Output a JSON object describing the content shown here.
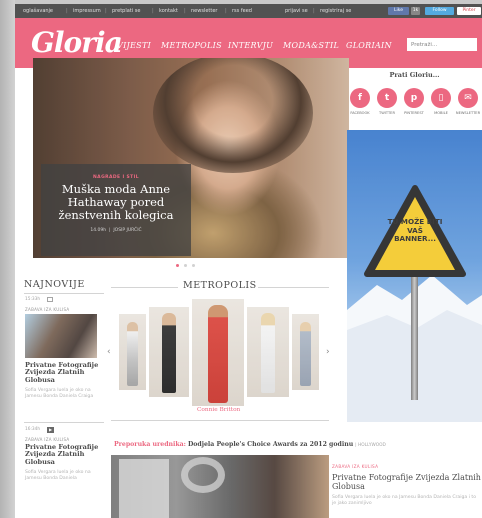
{
  "topbar": {
    "links": [
      "oglašavanje",
      "impressum",
      "pretplati se",
      "kontakt",
      "newsletter",
      "rss feed"
    ],
    "right_links": [
      "prijavi se",
      "registriraj se"
    ],
    "social": {
      "like": "Like",
      "count": "1k",
      "follow": "Follow",
      "pinterest": "Pinter"
    }
  },
  "header": {
    "logo": "Gloria",
    "nav": [
      "VIJESTI",
      "METROPOLIS",
      "INTERVJU",
      "MODA&STIL",
      "GLORIAIN"
    ],
    "search_placeholder": "Pretraži..."
  },
  "hero": {
    "kicker": "NAGRADE I STIL",
    "title": "Muška moda Anne Hathaway pored ženstvenih kolegica",
    "date": "14.09h",
    "author": "JOSIP JURČIĆ"
  },
  "follow": {
    "title": "Prati Gloriu...",
    "items": [
      {
        "label": "FACEBOOK",
        "glyph": "f",
        "icon": "facebook-icon"
      },
      {
        "label": "TWITTER",
        "glyph": "t",
        "icon": "twitter-icon"
      },
      {
        "label": "PINTEREST",
        "glyph": "p",
        "icon": "pinterest-icon"
      },
      {
        "label": "MOBILE",
        "glyph": "▯",
        "icon": "mobile-icon"
      },
      {
        "label": "NEWSLETTER",
        "glyph": "✉",
        "icon": "newsletter-icon"
      }
    ]
  },
  "banner": {
    "text": "TU MOŽE BITI VAŠ BANNER..."
  },
  "najnovije": {
    "title": "NAJNOVIJE",
    "items": [
      {
        "time": "15:33h",
        "category": "ZABAVA IZA KULISA",
        "title": "Privatne Fotografije Zvijezda Zlatnih Globusa",
        "summary": "Sofia Vergara luela je oko na Jamesu Bonda Daniela Craiga"
      },
      {
        "time": "16:34h",
        "category": "ZABAVA IZA KULISA",
        "title": "Privatne Fotografije Zvijezda Zlatnih Globusa",
        "summary": "Sofia Vergara luela je oko na Jamesu Bonda Daniela"
      }
    ]
  },
  "metropolis": {
    "title": "METROPOLIS",
    "caption": "Connie Britton",
    "prev": "‹",
    "next": "›"
  },
  "preporuka": {
    "label": "Preporuka urednika:",
    "headline": "Dodjela People's Choice Awards za 2012 godinu",
    "tag": "| HOLLYWOOD"
  },
  "promo": {
    "category": "ZABAVA IZA KULISA",
    "title": "Privatne Fotografije Zvijezda Zlatnih Globusa",
    "summary": "Sofia Vergara luela je oko na Jamesu Bonda Daniela Craiga i to je jako zanimljivo"
  },
  "colors": {
    "brand": "#ea5470",
    "topbar": "#3b3b3b"
  }
}
